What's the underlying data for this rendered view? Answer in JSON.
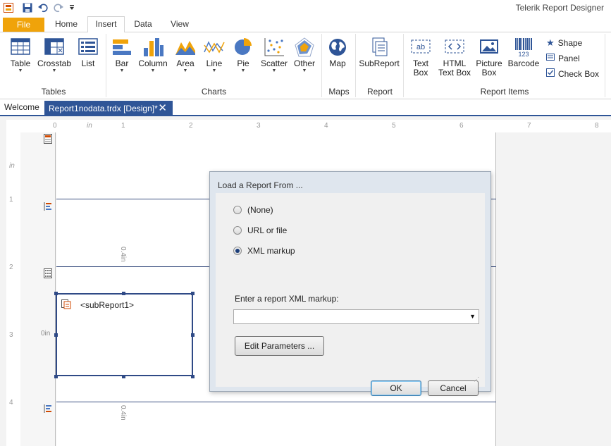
{
  "app": {
    "title": "Telerik Report Designer"
  },
  "quick_access": {
    "icons": [
      "app-icon",
      "save-icon",
      "undo-icon",
      "redo-icon",
      "customize-icon"
    ]
  },
  "ribbon_tabs": [
    "File",
    "Home",
    "Insert",
    "Data",
    "View"
  ],
  "ribbon": {
    "tables": {
      "label": "Tables",
      "items": [
        "Table",
        "Crosstab",
        "List"
      ]
    },
    "charts": {
      "label": "Charts",
      "items": [
        "Bar",
        "Column",
        "Area",
        "Line",
        "Pie",
        "Scatter",
        "Other"
      ]
    },
    "maps": {
      "label": "Maps",
      "items": [
        "Map"
      ]
    },
    "report": {
      "label": "Report",
      "items": [
        "SubReport"
      ]
    },
    "report_items": {
      "label": "Report Items",
      "items": [
        {
          "line1": "Text",
          "line2": "Box"
        },
        {
          "line1": "HTML",
          "line2": "Text Box"
        },
        {
          "line1": "Picture",
          "line2": "Box"
        },
        {
          "line1": "Barcode",
          "line2": ""
        }
      ],
      "small": [
        "Shape",
        "Panel",
        "Check Box"
      ],
      "barcode_digits": "123",
      "textbox_glyph": "ab"
    }
  },
  "doc_tabs": {
    "welcome": "Welcome",
    "active": "Report1nodata.trdx [Design]*"
  },
  "ruler": {
    "h_ticks": [
      "0",
      "in",
      "1",
      "2",
      "3",
      "4",
      "5",
      "6",
      "7",
      "8"
    ],
    "v_ticks": [
      "in",
      "1",
      "2",
      "3",
      "4"
    ]
  },
  "design": {
    "subreport_label": "<subReport1>",
    "dim_labels": [
      "0.4in",
      "0in",
      "0.4in"
    ]
  },
  "dialog": {
    "title": "Load a Report From ...",
    "options": [
      "(None)",
      "URL or file",
      "XML markup"
    ],
    "selected": "XML markup",
    "xml_label": "Enter a report XML markup:",
    "xml_value": "",
    "edit_button": "Edit Parameters ...",
    "ok_button": "OK",
    "cancel_button": "Cancel"
  },
  "colors": {
    "file_tab": "#f0a30a",
    "accent": "#2f5597",
    "chart_orange": "#f0a30a",
    "chart_blue": "#4a78c2"
  }
}
